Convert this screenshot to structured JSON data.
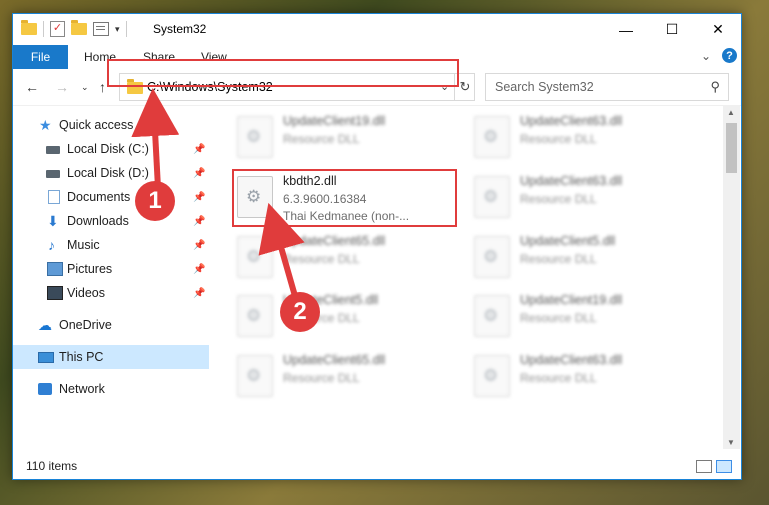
{
  "window": {
    "title": "System32"
  },
  "ribbon": {
    "tabs": [
      "File",
      "Home",
      "Share",
      "View"
    ],
    "help": "?"
  },
  "address": {
    "path": "C:\\Windows\\System32"
  },
  "search": {
    "placeholder": "Search System32"
  },
  "nav": {
    "items": [
      {
        "label": "Quick access",
        "icon": "star-icon",
        "pinned": false
      },
      {
        "label": "Local Disk (C:)",
        "icon": "drive-icon",
        "pinned": true
      },
      {
        "label": "Local Disk (D:)",
        "icon": "drive-icon",
        "pinned": true
      },
      {
        "label": "Documents",
        "icon": "documents-icon",
        "pinned": true
      },
      {
        "label": "Downloads",
        "icon": "download-icon",
        "pinned": true
      },
      {
        "label": "Music",
        "icon": "music-icon",
        "pinned": true
      },
      {
        "label": "Pictures",
        "icon": "pictures-icon",
        "pinned": true
      },
      {
        "label": "Videos",
        "icon": "videos-icon",
        "pinned": true
      },
      {
        "label": "OneDrive",
        "icon": "cloud-icon",
        "pinned": false
      },
      {
        "label": "This PC",
        "icon": "pc-icon",
        "pinned": false,
        "selected": true
      },
      {
        "label": "Network",
        "icon": "network-icon",
        "pinned": false
      }
    ]
  },
  "files": {
    "highlighted": {
      "name": "kbdth2.dll",
      "version": "6.3.9600.16384",
      "description": "Thai Kedmanee (non-..."
    },
    "left_column": [
      {
        "name": "UpdateClient19.dll",
        "type": "Resource DLL"
      },
      {
        "name": "UpdateClient65.dll",
        "type": "Resource DLL"
      },
      {
        "name": "UpdateClient5.dll",
        "type": "Resource DLL"
      },
      {
        "name": "UpdateClient65.dll",
        "type": "Resource DLL"
      }
    ],
    "right_column": [
      {
        "name": "UpdateClient63.dll",
        "type": "Resource DLL"
      },
      {
        "name": "UpdateClient63.dll",
        "type": "Resource DLL"
      },
      {
        "name": "UpdateClient5.dll",
        "type": "Resource DLL"
      },
      {
        "name": "UpdateClient19.dll",
        "type": "Resource DLL"
      },
      {
        "name": "UpdateClient63.dll",
        "type": "Resource DLL"
      }
    ]
  },
  "status": {
    "item_count": "110 items"
  },
  "annotations": {
    "step1": "1",
    "step2": "2",
    "color": "#e03c3c"
  }
}
